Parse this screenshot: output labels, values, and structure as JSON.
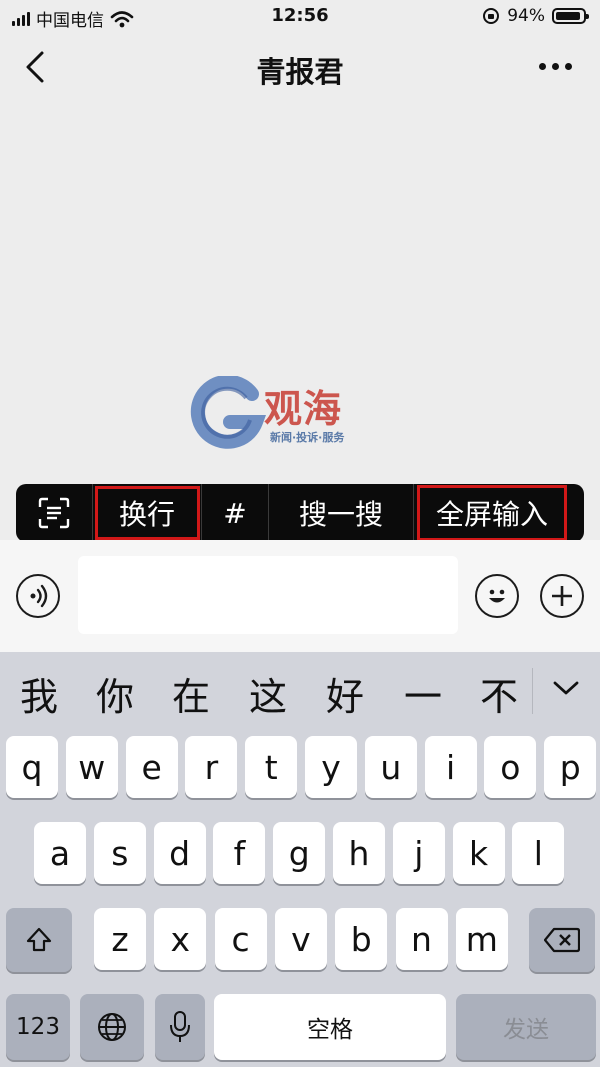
{
  "status_bar": {
    "carrier": "中国电信",
    "time": "12:56",
    "battery_percent": "94%",
    "battery_level": 0.94
  },
  "nav": {
    "title": "青报君"
  },
  "watermark": {
    "brand": "观海",
    "tagline": "新闻·投诉·服务"
  },
  "popup_menu": {
    "items": [
      "换行",
      "#",
      "搜一搜",
      "全屏输入"
    ]
  },
  "input": {
    "value": "",
    "placeholder": ""
  },
  "keyboard": {
    "candidates": [
      "我",
      "你",
      "在",
      "这",
      "好",
      "一",
      "不"
    ],
    "row1": [
      "q",
      "w",
      "e",
      "r",
      "t",
      "y",
      "u",
      "i",
      "o",
      "p"
    ],
    "row2": [
      "a",
      "s",
      "d",
      "f",
      "g",
      "h",
      "j",
      "k",
      "l"
    ],
    "row3": [
      "z",
      "x",
      "c",
      "v",
      "b",
      "n",
      "m"
    ],
    "numbers_key": "123",
    "space_key": "空格",
    "send_key": "发送"
  },
  "colors": {
    "background": "#ededed",
    "highlight": "#d11818",
    "popup": "#0b0b0b",
    "keyboard": "#d2d4db"
  }
}
